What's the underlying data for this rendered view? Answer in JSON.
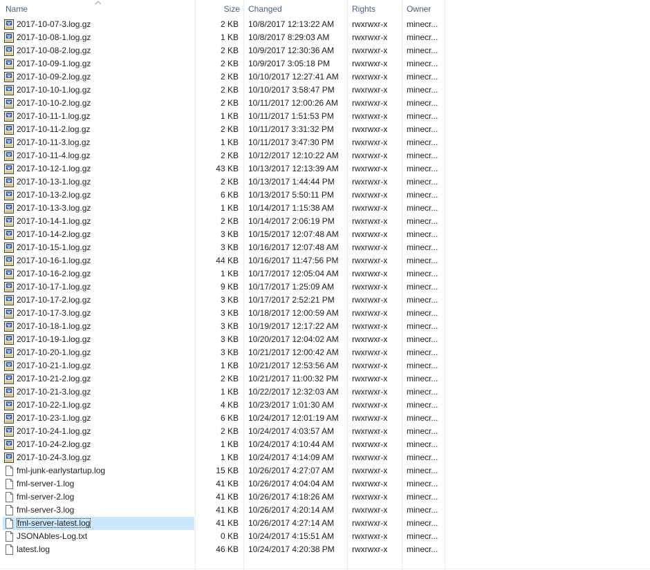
{
  "columns": {
    "name": "Name",
    "size": "Size",
    "changed": "Changed",
    "rights": "Rights",
    "owner": "Owner",
    "sorted_by": "name",
    "sort_direction": "ascending"
  },
  "files": [
    {
      "name": "2017-10-07-3.log.gz",
      "size": "2 KB",
      "changed": "10/8/2017 12:13:22 AM",
      "rights": "rwxrwxr-x",
      "owner": "minecr...",
      "icon": "archive-icon"
    },
    {
      "name": "2017-10-08-1.log.gz",
      "size": "1 KB",
      "changed": "10/8/2017 8:29:03 AM",
      "rights": "rwxrwxr-x",
      "owner": "minecr...",
      "icon": "archive-icon"
    },
    {
      "name": "2017-10-08-2.log.gz",
      "size": "2 KB",
      "changed": "10/9/2017 12:30:36 AM",
      "rights": "rwxrwxr-x",
      "owner": "minecr...",
      "icon": "archive-icon"
    },
    {
      "name": "2017-10-09-1.log.gz",
      "size": "2 KB",
      "changed": "10/9/2017 3:05:18 PM",
      "rights": "rwxrwxr-x",
      "owner": "minecr...",
      "icon": "archive-icon"
    },
    {
      "name": "2017-10-09-2.log.gz",
      "size": "2 KB",
      "changed": "10/10/2017 12:27:41 AM",
      "rights": "rwxrwxr-x",
      "owner": "minecr...",
      "icon": "archive-icon"
    },
    {
      "name": "2017-10-10-1.log.gz",
      "size": "2 KB",
      "changed": "10/10/2017 3:58:47 PM",
      "rights": "rwxrwxr-x",
      "owner": "minecr...",
      "icon": "archive-icon"
    },
    {
      "name": "2017-10-10-2.log.gz",
      "size": "2 KB",
      "changed": "10/11/2017 12:00:26 AM",
      "rights": "rwxrwxr-x",
      "owner": "minecr...",
      "icon": "archive-icon"
    },
    {
      "name": "2017-10-11-1.log.gz",
      "size": "1 KB",
      "changed": "10/11/2017 1:51:53 PM",
      "rights": "rwxrwxr-x",
      "owner": "minecr...",
      "icon": "archive-icon"
    },
    {
      "name": "2017-10-11-2.log.gz",
      "size": "2 KB",
      "changed": "10/11/2017 3:31:32 PM",
      "rights": "rwxrwxr-x",
      "owner": "minecr...",
      "icon": "archive-icon"
    },
    {
      "name": "2017-10-11-3.log.gz",
      "size": "1 KB",
      "changed": "10/11/2017 3:47:30 PM",
      "rights": "rwxrwxr-x",
      "owner": "minecr...",
      "icon": "archive-icon"
    },
    {
      "name": "2017-10-11-4.log.gz",
      "size": "2 KB",
      "changed": "10/12/2017 12:10:22 AM",
      "rights": "rwxrwxr-x",
      "owner": "minecr...",
      "icon": "archive-icon"
    },
    {
      "name": "2017-10-12-1.log.gz",
      "size": "43 KB",
      "changed": "10/13/2017 12:13:39 AM",
      "rights": "rwxrwxr-x",
      "owner": "minecr...",
      "icon": "archive-icon"
    },
    {
      "name": "2017-10-13-1.log.gz",
      "size": "2 KB",
      "changed": "10/13/2017 1:44:44 PM",
      "rights": "rwxrwxr-x",
      "owner": "minecr...",
      "icon": "archive-icon"
    },
    {
      "name": "2017-10-13-2.log.gz",
      "size": "6 KB",
      "changed": "10/13/2017 5:50:11 PM",
      "rights": "rwxrwxr-x",
      "owner": "minecr...",
      "icon": "archive-icon"
    },
    {
      "name": "2017-10-13-3.log.gz",
      "size": "1 KB",
      "changed": "10/14/2017 1:15:38 AM",
      "rights": "rwxrwxr-x",
      "owner": "minecr...",
      "icon": "archive-icon"
    },
    {
      "name": "2017-10-14-1.log.gz",
      "size": "2 KB",
      "changed": "10/14/2017 2:06:19 PM",
      "rights": "rwxrwxr-x",
      "owner": "minecr...",
      "icon": "archive-icon"
    },
    {
      "name": "2017-10-14-2.log.gz",
      "size": "3 KB",
      "changed": "10/15/2017 12:07:48 AM",
      "rights": "rwxrwxr-x",
      "owner": "minecr...",
      "icon": "archive-icon"
    },
    {
      "name": "2017-10-15-1.log.gz",
      "size": "3 KB",
      "changed": "10/16/2017 12:07:48 AM",
      "rights": "rwxrwxr-x",
      "owner": "minecr...",
      "icon": "archive-icon"
    },
    {
      "name": "2017-10-16-1.log.gz",
      "size": "44 KB",
      "changed": "10/16/2017 11:47:56 PM",
      "rights": "rwxrwxr-x",
      "owner": "minecr...",
      "icon": "archive-icon"
    },
    {
      "name": "2017-10-16-2.log.gz",
      "size": "1 KB",
      "changed": "10/17/2017 12:05:04 AM",
      "rights": "rwxrwxr-x",
      "owner": "minecr...",
      "icon": "archive-icon"
    },
    {
      "name": "2017-10-17-1.log.gz",
      "size": "9 KB",
      "changed": "10/17/2017 1:25:09 AM",
      "rights": "rwxrwxr-x",
      "owner": "minecr...",
      "icon": "archive-icon"
    },
    {
      "name": "2017-10-17-2.log.gz",
      "size": "3 KB",
      "changed": "10/17/2017 2:52:21 PM",
      "rights": "rwxrwxr-x",
      "owner": "minecr...",
      "icon": "archive-icon"
    },
    {
      "name": "2017-10-17-3.log.gz",
      "size": "3 KB",
      "changed": "10/18/2017 12:00:59 AM",
      "rights": "rwxrwxr-x",
      "owner": "minecr...",
      "icon": "archive-icon"
    },
    {
      "name": "2017-10-18-1.log.gz",
      "size": "3 KB",
      "changed": "10/19/2017 12:17:22 AM",
      "rights": "rwxrwxr-x",
      "owner": "minecr...",
      "icon": "archive-icon"
    },
    {
      "name": "2017-10-19-1.log.gz",
      "size": "3 KB",
      "changed": "10/20/2017 12:04:02 AM",
      "rights": "rwxrwxr-x",
      "owner": "minecr...",
      "icon": "archive-icon"
    },
    {
      "name": "2017-10-20-1.log.gz",
      "size": "3 KB",
      "changed": "10/21/2017 12:00:42 AM",
      "rights": "rwxrwxr-x",
      "owner": "minecr...",
      "icon": "archive-icon"
    },
    {
      "name": "2017-10-21-1.log.gz",
      "size": "1 KB",
      "changed": "10/21/2017 12:53:56 AM",
      "rights": "rwxrwxr-x",
      "owner": "minecr...",
      "icon": "archive-icon"
    },
    {
      "name": "2017-10-21-2.log.gz",
      "size": "2 KB",
      "changed": "10/21/2017 11:00:32 PM",
      "rights": "rwxrwxr-x",
      "owner": "minecr...",
      "icon": "archive-icon"
    },
    {
      "name": "2017-10-21-3.log.gz",
      "size": "1 KB",
      "changed": "10/22/2017 12:32:03 AM",
      "rights": "rwxrwxr-x",
      "owner": "minecr...",
      "icon": "archive-icon"
    },
    {
      "name": "2017-10-22-1.log.gz",
      "size": "4 KB",
      "changed": "10/23/2017 1:01:30 AM",
      "rights": "rwxrwxr-x",
      "owner": "minecr...",
      "icon": "archive-icon"
    },
    {
      "name": "2017-10-23-1.log.gz",
      "size": "6 KB",
      "changed": "10/24/2017 12:01:19 AM",
      "rights": "rwxrwxr-x",
      "owner": "minecr...",
      "icon": "archive-icon"
    },
    {
      "name": "2017-10-24-1.log.gz",
      "size": "2 KB",
      "changed": "10/24/2017 4:03:57 AM",
      "rights": "rwxrwxr-x",
      "owner": "minecr...",
      "icon": "archive-icon"
    },
    {
      "name": "2017-10-24-2.log.gz",
      "size": "1 KB",
      "changed": "10/24/2017 4:10:44 AM",
      "rights": "rwxrwxr-x",
      "owner": "minecr...",
      "icon": "archive-icon"
    },
    {
      "name": "2017-10-24-3.log.gz",
      "size": "1 KB",
      "changed": "10/24/2017 4:14:09 AM",
      "rights": "rwxrwxr-x",
      "owner": "minecr...",
      "icon": "archive-icon"
    },
    {
      "name": "fml-junk-earlystartup.log",
      "size": "15 KB",
      "changed": "10/26/2017 4:27:07 AM",
      "rights": "rwxrwxr-x",
      "owner": "minecr...",
      "icon": "text-file-icon"
    },
    {
      "name": "fml-server-1.log",
      "size": "41 KB",
      "changed": "10/26/2017 4:04:04 AM",
      "rights": "rwxrwxr-x",
      "owner": "minecr...",
      "icon": "text-file-icon"
    },
    {
      "name": "fml-server-2.log",
      "size": "41 KB",
      "changed": "10/26/2017 4:18:26 AM",
      "rights": "rwxrwxr-x",
      "owner": "minecr...",
      "icon": "text-file-icon"
    },
    {
      "name": "fml-server-3.log",
      "size": "41 KB",
      "changed": "10/26/2017 4:20:14 AM",
      "rights": "rwxrwxr-x",
      "owner": "minecr...",
      "icon": "text-file-icon"
    },
    {
      "name": "fml-server-latest.log",
      "size": "41 KB",
      "changed": "10/26/2017 4:27:14 AM",
      "rights": "rwxrwxr-x",
      "owner": "minecr...",
      "icon": "text-file-icon",
      "selected": true
    },
    {
      "name": "JSONAbles-Log.txt",
      "size": "0 KB",
      "changed": "10/24/2017 4:15:51 AM",
      "rights": "rwxrwxr-x",
      "owner": "minecr...",
      "icon": "text-file-icon"
    },
    {
      "name": "latest.log",
      "size": "46 KB",
      "changed": "10/24/2017 4:20:38 PM",
      "rights": "rwxrwxr-x",
      "owner": "minecr...",
      "icon": "text-file-icon"
    }
  ],
  "colors": {
    "header_text": "#4c607a",
    "selection": "#cce8ff",
    "grid_line": "#e9e9e9"
  }
}
